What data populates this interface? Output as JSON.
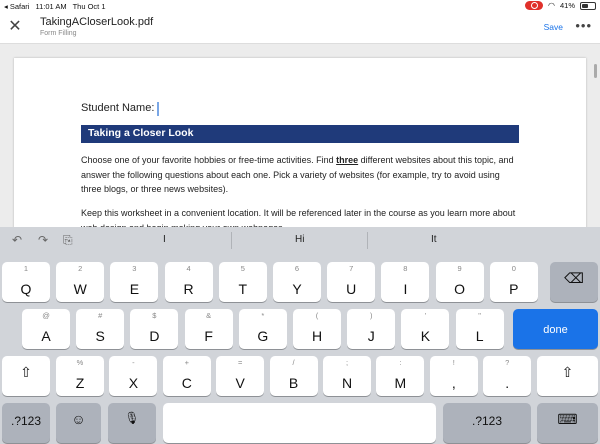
{
  "status": {
    "back_app": "◂ Safari",
    "time": "11:01 AM",
    "date": "Thu Oct 1",
    "battery": "41%"
  },
  "header": {
    "filename": "TakingACloserLook.pdf",
    "subtitle": "Form Filling",
    "save_label": "Save",
    "more_label": "•••",
    "close_label": "✕"
  },
  "document": {
    "student_label": "Student Name:",
    "section_title": "Taking a Closer Look",
    "para1_pre": "Choose one of your favorite hobbies or free-time activities. Find ",
    "para1_bold": "three",
    "para1_post": " different websites about this topic, and answer the following questions about each one. Pick a variety of websites (for example, try to avoid using three blogs, or three news websites).",
    "para2": "Keep this worksheet in a convenient location. It will be referenced later in the course as you learn more about web design and begin making your own webpages."
  },
  "keyboard": {
    "predictions": [
      "I",
      "Hi",
      "It"
    ],
    "row1": [
      {
        "hint": "1",
        "key": "Q"
      },
      {
        "hint": "2",
        "key": "W"
      },
      {
        "hint": "3",
        "key": "E"
      },
      {
        "hint": "4",
        "key": "R"
      },
      {
        "hint": "5",
        "key": "T"
      },
      {
        "hint": "6",
        "key": "Y"
      },
      {
        "hint": "7",
        "key": "U"
      },
      {
        "hint": "8",
        "key": "I"
      },
      {
        "hint": "9",
        "key": "O"
      },
      {
        "hint": "0",
        "key": "P"
      }
    ],
    "row2": [
      {
        "hint": "@",
        "key": "A"
      },
      {
        "hint": "#",
        "key": "S"
      },
      {
        "hint": "$",
        "key": "D"
      },
      {
        "hint": "&",
        "key": "F"
      },
      {
        "hint": "*",
        "key": "G"
      },
      {
        "hint": "(",
        "key": "H"
      },
      {
        "hint": ")",
        "key": "J"
      },
      {
        "hint": "'",
        "key": "K"
      },
      {
        "hint": "\"",
        "key": "L"
      }
    ],
    "row3": [
      {
        "hint": "%",
        "key": "Z"
      },
      {
        "hint": "-",
        "key": "X"
      },
      {
        "hint": "+",
        "key": "C"
      },
      {
        "hint": "=",
        "key": "V"
      },
      {
        "hint": "/",
        "key": "B"
      },
      {
        "hint": ";",
        "key": "N"
      },
      {
        "hint": ":",
        "key": "M"
      },
      {
        "hint": "!",
        "key": ","
      },
      {
        "hint": "?",
        "key": "."
      }
    ],
    "done_label": "done",
    "num_label": ".?123",
    "undo": "↶",
    "redo": "↷",
    "paste": "⎘",
    "delete": "⌫",
    "shift": "⇧",
    "emoji": "☺",
    "mic": "🎙",
    "hide": "⌨"
  }
}
